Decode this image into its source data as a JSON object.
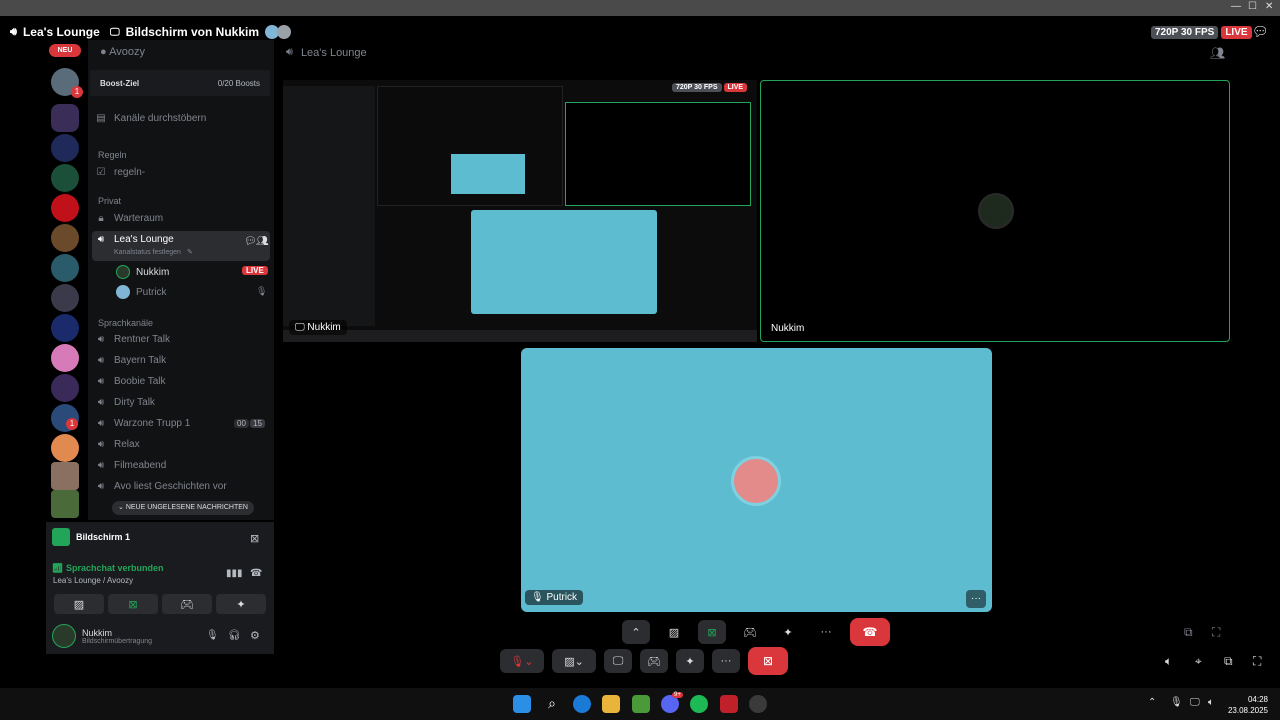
{
  "window": {
    "min": "—",
    "max": "☐",
    "close": "✕"
  },
  "stream_header": {
    "channel": "Lea's Lounge",
    "screen_of": "Bildschirm von Nukkim",
    "resolution": "720P 30 FPS",
    "live": "LIVE"
  },
  "rail": {
    "new_badge": "NEU",
    "badge_1": "1",
    "badge_2": "1"
  },
  "channels": {
    "server_name": "Avoozy",
    "boost_label": "Boost-Ziel",
    "boost_count": "0/20 Boosts",
    "browse": "Kanäle durchstöbern",
    "cat_rules": "Regeln",
    "rules_channel": "regeln-",
    "cat_private": "Privat",
    "waiting_room": "Warteraum",
    "active_channel": "Lea's Lounge",
    "active_status": "Kanalstatus festlegen",
    "member_1": "Nukkim",
    "member_1_badge": "LIVE",
    "member_2": "Putrick",
    "cat_voice": "Sprachkanäle",
    "voice": [
      "Rentner Talk",
      "Bayern Talk",
      "Boobie Talk",
      "Dirty Talk",
      "Warzone Trupp 1",
      "Relax",
      "Filmeabend",
      "Avo liest Geschichten vor"
    ],
    "warzone_count_a": "00",
    "warzone_count_b": "15",
    "unread": "NEUE UNGELESENE NACHRICHTEN"
  },
  "voice_panel": {
    "screen": "Bildschirm 1",
    "connected": "Sprachchat verbunden",
    "location": "Lea's Lounge / Avoozy",
    "user": "Nukkim",
    "user_status": "Bildschirmübertragung"
  },
  "main": {
    "title": "Lea's Lounge",
    "tile_left_label": "Nukkim",
    "tile_right_label": "Nukkim",
    "tile_bottom_label": "Putrick",
    "inner_resolution": "720P 30 FPS",
    "inner_live": "LIVE",
    "more": "···"
  },
  "taskbar": {
    "clock_time": "04:28",
    "clock_date": "23.08.2025",
    "discord_badge": "9+"
  },
  "colors": {
    "accent": "#5865f2",
    "live": "#da373c",
    "connected": "#23a559",
    "stream_bg": "#5ebcd1"
  }
}
